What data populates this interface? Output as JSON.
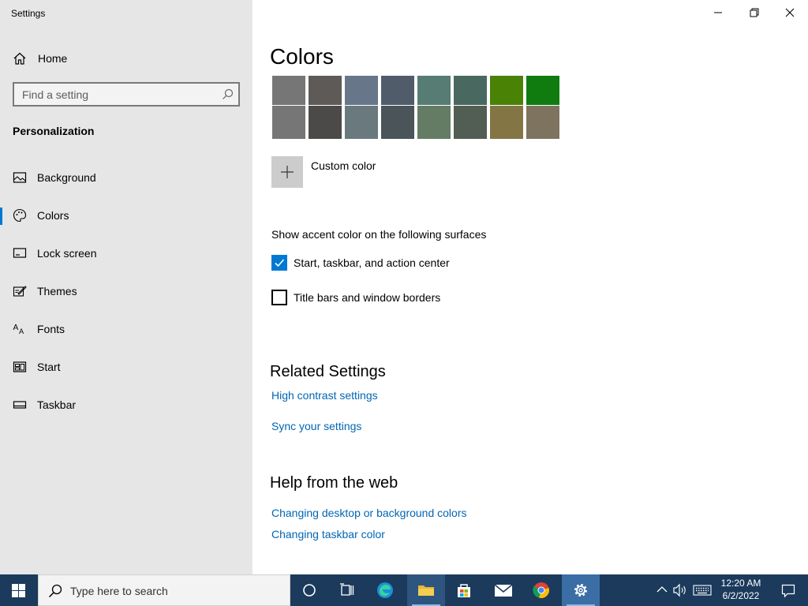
{
  "window": {
    "title": "Settings"
  },
  "sidebar": {
    "home_label": "Home",
    "search_placeholder": "Find a setting",
    "section_title": "Personalization",
    "items": [
      {
        "label": "Background",
        "icon": "image-icon",
        "selected": false
      },
      {
        "label": "Colors",
        "icon": "palette-icon",
        "selected": true
      },
      {
        "label": "Lock screen",
        "icon": "lock-screen-icon",
        "selected": false
      },
      {
        "label": "Themes",
        "icon": "themes-icon",
        "selected": false
      },
      {
        "label": "Fonts",
        "icon": "fonts-icon",
        "selected": false
      },
      {
        "label": "Start",
        "icon": "start-icon",
        "selected": false
      },
      {
        "label": "Taskbar",
        "icon": "taskbar-icon",
        "selected": false
      }
    ]
  },
  "main": {
    "title": "Colors",
    "swatches_row1": [
      "#767676",
      "#5d5a58",
      "#68768a",
      "#515c6b",
      "#567c73",
      "#486860",
      "#498205",
      "#107c10"
    ],
    "swatches_row2": [
      "#767676",
      "#4c4a48",
      "#69797e",
      "#4a5459",
      "#647c64",
      "#525e54",
      "#847545",
      "#7e735f"
    ],
    "custom_color_label": "Custom color",
    "surfaces_label": "Show accent color on the following surfaces",
    "checkboxes": [
      {
        "label": "Start, taskbar, and action center",
        "checked": true
      },
      {
        "label": "Title bars and window borders",
        "checked": false
      }
    ],
    "related_heading": "Related Settings",
    "related_links": [
      "High contrast settings",
      "Sync your settings"
    ],
    "help_heading": "Help from the web",
    "help_links": [
      "Changing desktop or background colors",
      "Changing taskbar color"
    ]
  },
  "taskbar": {
    "search_placeholder": "Type here to search",
    "time": "12:20 AM",
    "date": "6/2/2022"
  },
  "colors": {
    "accent": "#0078d4",
    "link": "#0066b4",
    "taskbar_bg": "#1b3a5c",
    "sidebar_bg": "#e6e6e6"
  }
}
